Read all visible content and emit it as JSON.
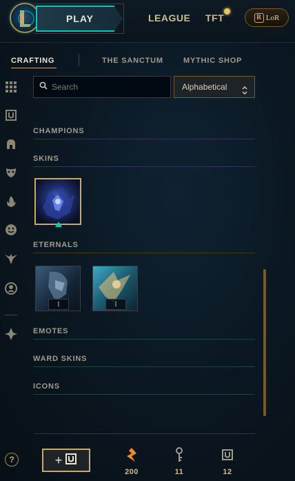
{
  "nav": {
    "play_label": "PLAY",
    "league_label": "LEAGUE",
    "tft_label": "TFT",
    "lor_label": "LoR",
    "lor_icon_letter": "R"
  },
  "subtabs": {
    "crafting": "CRAFTING",
    "sanctum": "THE SANCTUM",
    "mythic": "MYTHIC SHOP"
  },
  "search": {
    "placeholder": "Search",
    "value": ""
  },
  "sort": {
    "selected": "Alphabetical"
  },
  "sections": {
    "champions": "CHAMPIONS",
    "skins": "SKINS",
    "eternals": "ETERNALS",
    "emotes": "EMOTES",
    "ward_skins": "WARD SKINS",
    "icons": "ICONS"
  },
  "eternals": [
    {
      "badge": "I"
    },
    {
      "badge": "I"
    }
  ],
  "sidebar_icons": [
    "grid-icon",
    "chest-icon",
    "helmet-icon",
    "mask-icon",
    "flame-icon",
    "emote-icon",
    "ward-icon",
    "profile-icon",
    "loot-icon"
  ],
  "bottom": {
    "add_symbol": "+",
    "currencies": [
      {
        "name": "orange-essence-icon",
        "value": "200"
      },
      {
        "name": "key-icon",
        "value": "11"
      },
      {
        "name": "chest-icon",
        "value": "12"
      }
    ]
  },
  "help_label": "?",
  "colors": {
    "gold": "#c8aa6e",
    "teal": "#0ac8b9",
    "orange": "#f08a2c",
    "background": "#0a1620"
  }
}
